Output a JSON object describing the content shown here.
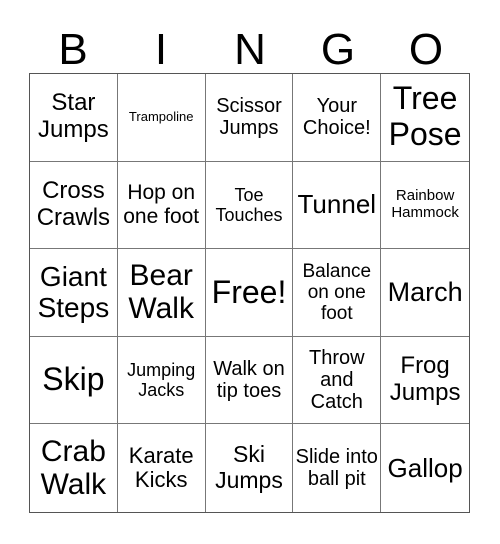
{
  "title_letters": [
    "B",
    "I",
    "N",
    "G",
    "O"
  ],
  "cells": [
    {
      "text": "Star Jumps",
      "size": 24
    },
    {
      "text": "Trampoline",
      "size": 13
    },
    {
      "text": "Scissor Jumps",
      "size": 20
    },
    {
      "text": "Your Choice!",
      "size": 20
    },
    {
      "text": "Tree Pose",
      "size": 32
    },
    {
      "text": "Cross Crawls",
      "size": 24
    },
    {
      "text": "Hop on one foot",
      "size": 21
    },
    {
      "text": "Toe Touches",
      "size": 18
    },
    {
      "text": "Tunnel",
      "size": 26
    },
    {
      "text": "Rainbow Hammock",
      "size": 15
    },
    {
      "text": "Giant Steps",
      "size": 28
    },
    {
      "text": "Bear Walk",
      "size": 30
    },
    {
      "text": "Free!",
      "size": 32
    },
    {
      "text": "Balance on one foot",
      "size": 19
    },
    {
      "text": "March",
      "size": 27
    },
    {
      "text": "Skip",
      "size": 32
    },
    {
      "text": "Jumping Jacks",
      "size": 18
    },
    {
      "text": "Walk on tip toes",
      "size": 20
    },
    {
      "text": "Throw and Catch",
      "size": 20
    },
    {
      "text": "Frog Jumps",
      "size": 24
    },
    {
      "text": "Crab Walk",
      "size": 30
    },
    {
      "text": "Karate Kicks",
      "size": 22
    },
    {
      "text": "Ski Jumps",
      "size": 23
    },
    {
      "text": "Slide into ball pit",
      "size": 20
    },
    {
      "text": "Gallop",
      "size": 26
    }
  ]
}
